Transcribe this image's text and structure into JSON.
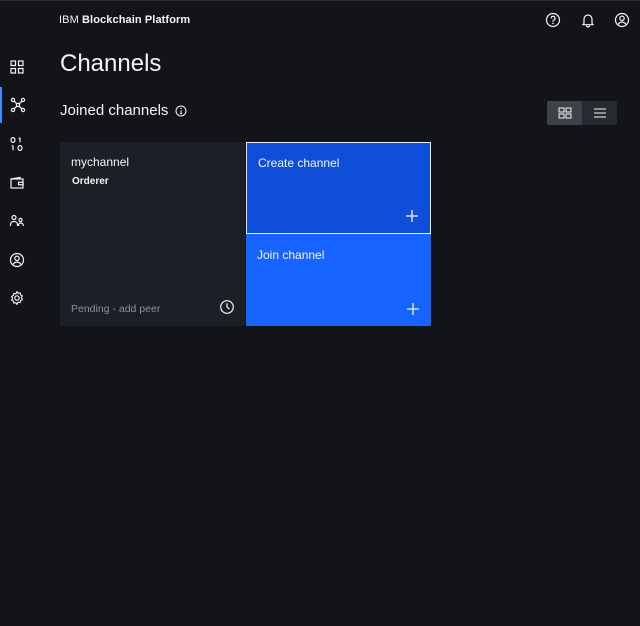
{
  "header": {
    "brand_prefix": "IBM",
    "brand_name": "Blockchain Platform",
    "icons": [
      "help-icon",
      "notification-icon",
      "user-profile-icon"
    ]
  },
  "sidebar": {
    "items": [
      {
        "name": "nodes",
        "icon": "grid-icon",
        "active": false
      },
      {
        "name": "channels",
        "icon": "network-icon",
        "active": true
      },
      {
        "name": "smart-contracts",
        "icon": "binary-icon",
        "active": false
      },
      {
        "name": "wallet",
        "icon": "wallet-icon",
        "active": false
      },
      {
        "name": "organizations",
        "icon": "users-icon",
        "active": false
      },
      {
        "name": "users",
        "icon": "user-circle-icon",
        "active": false
      },
      {
        "name": "settings",
        "icon": "settings-icon",
        "active": false
      }
    ]
  },
  "main": {
    "title": "Channels",
    "section_title": "Joined channels",
    "view_toggle": {
      "selected": "tile"
    },
    "channels": [
      {
        "name": "mychannel",
        "role": "Orderer",
        "status": "Pending - add peer"
      }
    ],
    "actions": {
      "create": "Create channel",
      "join": "Join channel"
    }
  },
  "colors": {
    "background": "#121419",
    "tile": "#1c1f25",
    "create_tile": "#0f4ed9",
    "join_tile": "#1763ff",
    "active_indicator": "#4589ff"
  }
}
